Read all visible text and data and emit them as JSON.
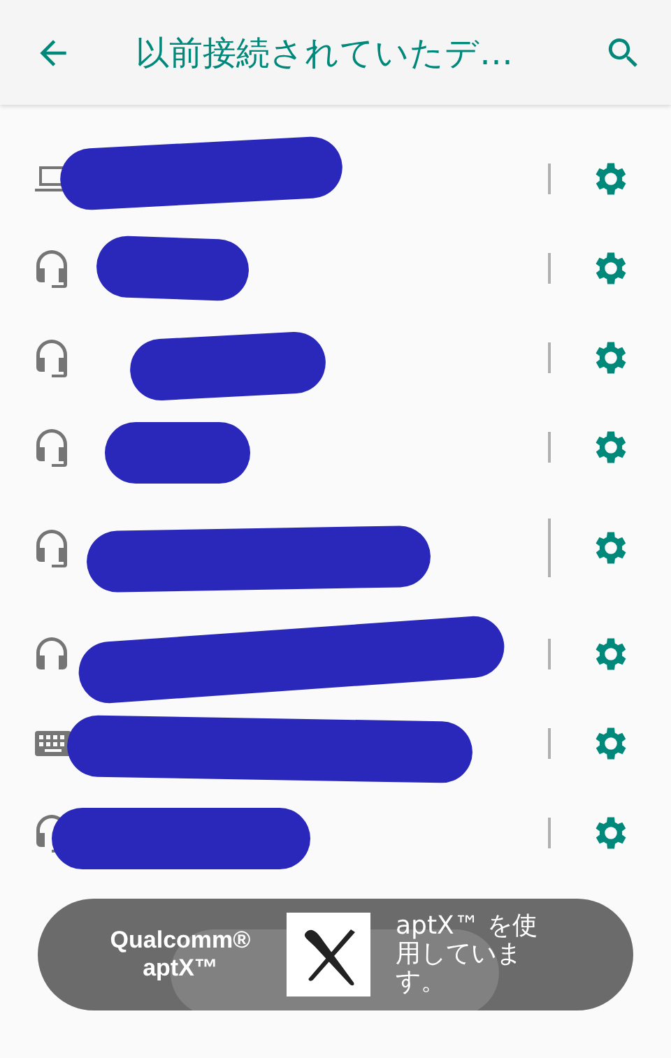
{
  "app_bar": {
    "title": "以前接続されていたデ…"
  },
  "devices": [
    {
      "kind": "laptop",
      "tall": false
    },
    {
      "kind": "headset",
      "tall": false
    },
    {
      "kind": "headset",
      "tall": false
    },
    {
      "kind": "headset",
      "tall": false
    },
    {
      "kind": "headset",
      "tall": true
    },
    {
      "kind": "headphones",
      "tall": false
    },
    {
      "kind": "keyboard",
      "tall": false
    },
    {
      "kind": "headset",
      "tall": false
    }
  ],
  "toast": {
    "brand_line_1": "Qualcomm®",
    "brand_line_2": "aptX™",
    "message": "aptX™ を使用しています。"
  }
}
